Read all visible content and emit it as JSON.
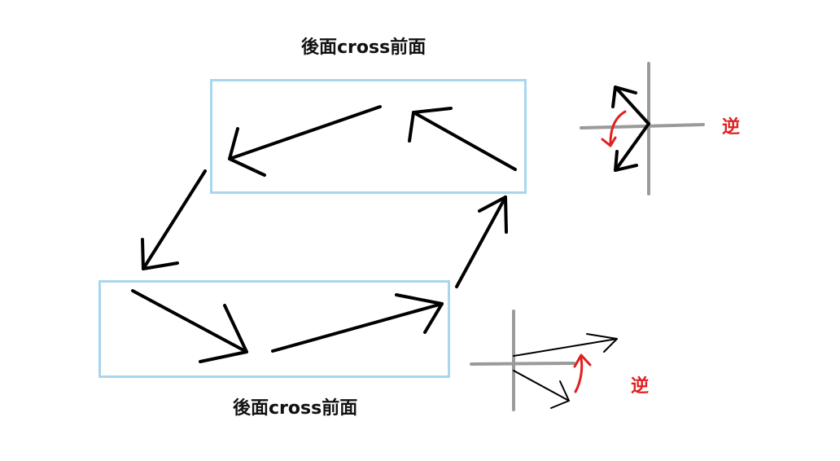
{
  "labels": {
    "top_caption": "後面cross前面",
    "bottom_caption": "後面cross前面",
    "top_right_mark": "逆",
    "bottom_right_mark": "逆"
  },
  "colors": {
    "box_border": "#a9d6ee",
    "arrow": "#000000",
    "axis": "#9a9a9a",
    "rotation": "#e02020"
  },
  "icons": {
    "top_rotation": "counter-clockwise-arrow-icon",
    "bottom_rotation": "counter-clockwise-arrow-icon"
  }
}
